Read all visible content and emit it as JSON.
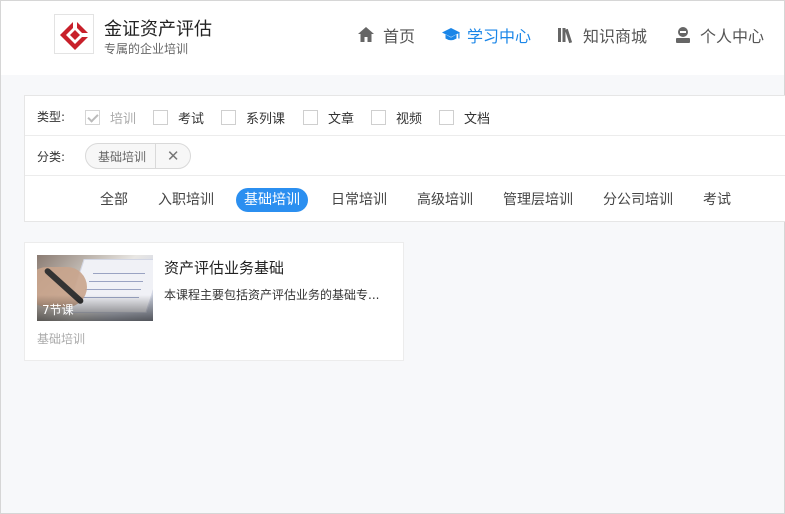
{
  "header": {
    "brand_title": "金证资产评估",
    "brand_subtitle": "专属的企业培训",
    "nav": {
      "home": "首页",
      "learning": "学习中心",
      "shop": "知识商城",
      "profile": "个人中心"
    },
    "active_nav": "learning",
    "accent_color": "#1a86e8",
    "logo_color": "#c8202a"
  },
  "filters": {
    "type_label": "类型:",
    "types": [
      {
        "label": "培训",
        "checked": true
      },
      {
        "label": "考试",
        "checked": false
      },
      {
        "label": "系列课",
        "checked": false
      },
      {
        "label": "文章",
        "checked": false
      },
      {
        "label": "视频",
        "checked": false
      },
      {
        "label": "文档",
        "checked": false
      }
    ],
    "category_label": "分类:",
    "selected_category_chip": "基础培训",
    "chip_close_icon": "close-icon",
    "tabs": [
      "全部",
      "入职培训",
      "基础培训",
      "日常培训",
      "高级培训",
      "管理层培训",
      "分公司培训",
      "考试"
    ],
    "active_tab": "基础培训"
  },
  "courses": [
    {
      "title": "资产评估业务基础",
      "description": "本课程主要包括资产评估业务的基础专...",
      "lesson_count": "7节课",
      "tag": "基础培训"
    }
  ]
}
